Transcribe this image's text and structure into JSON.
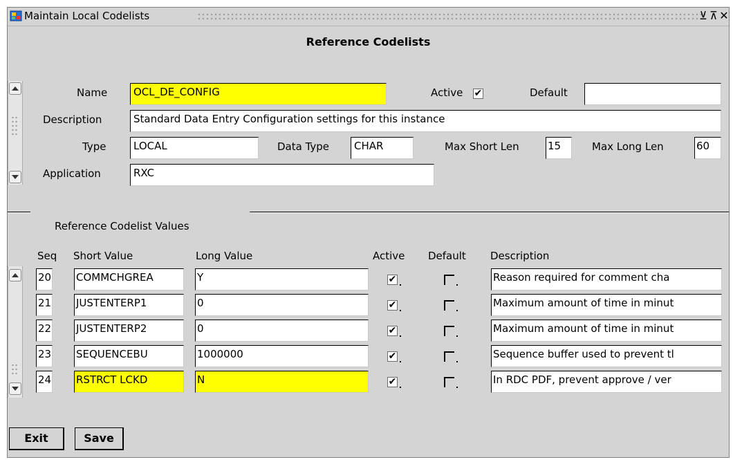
{
  "window": {
    "title": "Maintain Local Codelists",
    "minimize_glyph": "⊻",
    "maximize_glyph": "⊼",
    "close_glyph": "✕"
  },
  "heading": "Reference Codelists",
  "header_form": {
    "name_label": "Name",
    "name_value": "OCL_DE_CONFIG",
    "active_label": "Active",
    "active_checked": true,
    "default_label": "Default",
    "default_value": "",
    "description_label": "Description",
    "description_value": "Standard Data Entry Configuration settings for this instance",
    "type_label": "Type",
    "type_value": "LOCAL",
    "data_type_label": "Data Type",
    "data_type_value": "CHAR",
    "max_short_len_label": "Max Short Len",
    "max_short_len_value": "15",
    "max_long_len_label": "Max Long Len",
    "max_long_len_value": "60",
    "application_label": "Application",
    "application_value": "RXC"
  },
  "values_section": {
    "title": "Reference Codelist Values",
    "columns": {
      "seq": "Seq",
      "short_value": "Short Value",
      "long_value": "Long Value",
      "active": "Active",
      "default": "Default",
      "description": "Description"
    },
    "rows": [
      {
        "seq": "20",
        "short_value": "COMMCHGREA",
        "long_value": "Y",
        "active": true,
        "default": false,
        "description": "Reason required for comment cha"
      },
      {
        "seq": "21",
        "short_value": "JUSTENTERP1",
        "long_value": "0",
        "active": true,
        "default": false,
        "description": "Maximum amount of time in minut"
      },
      {
        "seq": "22",
        "short_value": "JUSTENTERP2",
        "long_value": "0",
        "active": true,
        "default": false,
        "description": "Maximum amount of time in minut"
      },
      {
        "seq": "23",
        "short_value": "SEQUENCEBU",
        "long_value": "1000000",
        "active": true,
        "default": false,
        "description": "Sequence buffer used to prevent tl"
      },
      {
        "seq": "24",
        "short_value": "RSTRCT LCKD",
        "long_value": "N",
        "active": true,
        "default": false,
        "description": "In RDC PDF, prevent approve / ver"
      }
    ]
  },
  "buttons": {
    "exit_label": "Exit",
    "save_label": "Save"
  },
  "colors": {
    "highlight": "#ffff00",
    "window_bg": "#d4d4d4"
  },
  "icons": [
    "app-icon",
    "scroll-up-icon",
    "scroll-down-icon",
    "checkmark-icon"
  ]
}
